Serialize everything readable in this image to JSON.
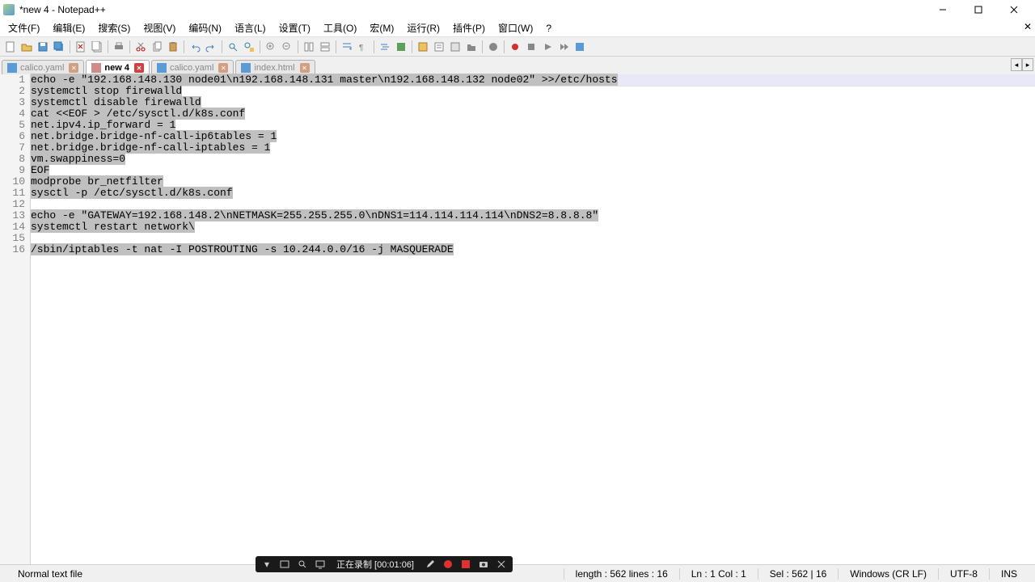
{
  "window": {
    "title": "*new 4 - Notepad++"
  },
  "menu": {
    "file": "文件(F)",
    "edit": "编辑(E)",
    "search": "搜索(S)",
    "view": "视图(V)",
    "encoding": "编码(N)",
    "language": "语言(L)",
    "settings": "设置(T)",
    "tools": "工具(O)",
    "macro": "宏(M)",
    "run": "运行(R)",
    "plugins": "插件(P)",
    "window": "窗口(W)",
    "help": "?"
  },
  "tabs": [
    {
      "label": "calico.yaml",
      "type": "yaml",
      "active": false
    },
    {
      "label": "new 4",
      "type": "txt",
      "active": true
    },
    {
      "label": "calico.yaml",
      "type": "yaml",
      "active": false
    },
    {
      "label": "index.html",
      "type": "html",
      "active": false
    }
  ],
  "lines": [
    "echo -e \"192.168.148.130 node01\\n192.168.148.131 master\\n192.168.148.132 node02\" >>/etc/hosts",
    "systemctl stop firewalld",
    "systemctl disable firewalld",
    "cat <<EOF > /etc/sysctl.d/k8s.conf",
    "net.ipv4.ip_forward = 1",
    "net.bridge.bridge-nf-call-ip6tables = 1",
    "net.bridge.bridge-nf-call-iptables = 1",
    "vm.swappiness=0",
    "EOF",
    "modprobe br_netfilter",
    "sysctl -p /etc/sysctl.d/k8s.conf",
    "",
    "echo -e \"GATEWAY=192.168.148.2\\nNETMASK=255.255.255.0\\nDNS1=114.114.114.114\\nDNS2=8.8.8.8\"",
    "systemctl restart network\\",
    "",
    "/sbin/iptables -t nat -I POSTROUTING -s 10.244.0.0/16 -j MASQUERADE"
  ],
  "status": {
    "filetype": "Normal text file",
    "length": "length : 562    lines : 16",
    "pos": "Ln : 1    Col : 1",
    "sel": "Sel : 562 | 16",
    "eol": "Windows (CR LF)",
    "encoding": "UTF-8",
    "mode": "INS"
  },
  "recorder": {
    "label": "正在录制 [00:01:06]"
  }
}
